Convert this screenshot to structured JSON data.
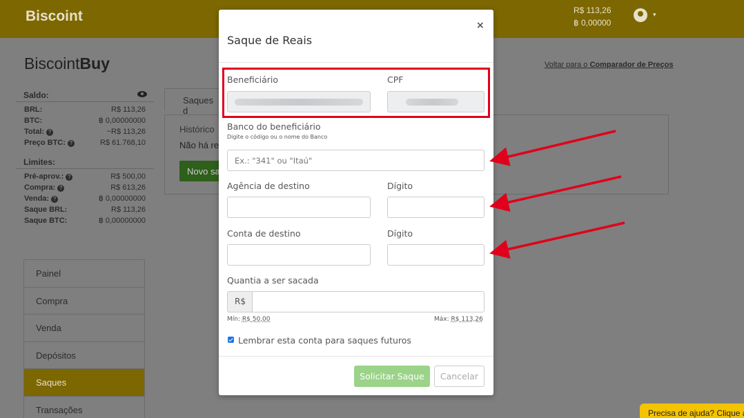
{
  "header": {
    "logo": "Biscoint",
    "balance_brl": "R$ 113,26",
    "balance_btc": "฿ 0,00000"
  },
  "page": {
    "title_light": "Biscoint",
    "title_bold": "Buy",
    "back_link_prefix": "Voltar para o",
    "back_link_bold": "Comparador de Preços"
  },
  "saldo": {
    "title": "Saldo:",
    "rows": [
      {
        "key": "BRL:",
        "value": "R$ 113,26"
      },
      {
        "key": "BTC:",
        "value": "฿ 0,00000000"
      },
      {
        "key": "Total:",
        "value": "~R$ 113,26",
        "help": true
      },
      {
        "key": "Preço BTC:",
        "value": "R$ 61.768,10",
        "help": true
      }
    ]
  },
  "limites": {
    "title": "Limites:",
    "rows": [
      {
        "key": "Pré-aprov.:",
        "value": "R$ 500,00",
        "help": true
      },
      {
        "key": "Compra:",
        "value": "R$ 613,26",
        "help": true
      },
      {
        "key": "Venda:",
        "value": "฿ 0,00000000",
        "help": true
      },
      {
        "key": "Saque BRL:",
        "value": "R$ 113,26"
      },
      {
        "key": "Saque BTC:",
        "value": "฿ 0,00000000"
      }
    ]
  },
  "nav": {
    "items": [
      "Painel",
      "Compra",
      "Venda",
      "Depósitos",
      "Saques",
      "Transações"
    ],
    "active": "Saques"
  },
  "content": {
    "tab": "Saques d",
    "card_title": "Histórico",
    "card_empty": "Não há re",
    "card_button": "Novo sa"
  },
  "help_tab": "Precisa de ajuda? Clique a",
  "modal": {
    "title": "Saque de Reais",
    "close": "×",
    "beneficiario_label": "Beneficiário",
    "cpf_label": "CPF",
    "banco_label": "Banco do beneficiário",
    "banco_hint": "Digite o código ou o nome do Banco",
    "banco_placeholder": "Ex.: \"341\" ou \"Itaú\"",
    "agencia_label": "Agência de destino",
    "agencia_digito_label": "Dígito",
    "conta_label": "Conta de destino",
    "conta_digito_label": "Dígito",
    "quantia_label": "Quantia a ser sacada",
    "currency_addon": "R$",
    "min_label": "Mín:",
    "min_value": "R$ 50,00",
    "max_label": "Máx:",
    "max_value": "R$ 113,26",
    "remember_label": "Lembrar esta conta para saques futuros",
    "submit_label": "Solicitar Saque",
    "cancel_label": "Cancelar"
  },
  "colors": {
    "brand": "#f4c400",
    "annotation": "#e0001b",
    "submit": "#9bd389"
  }
}
